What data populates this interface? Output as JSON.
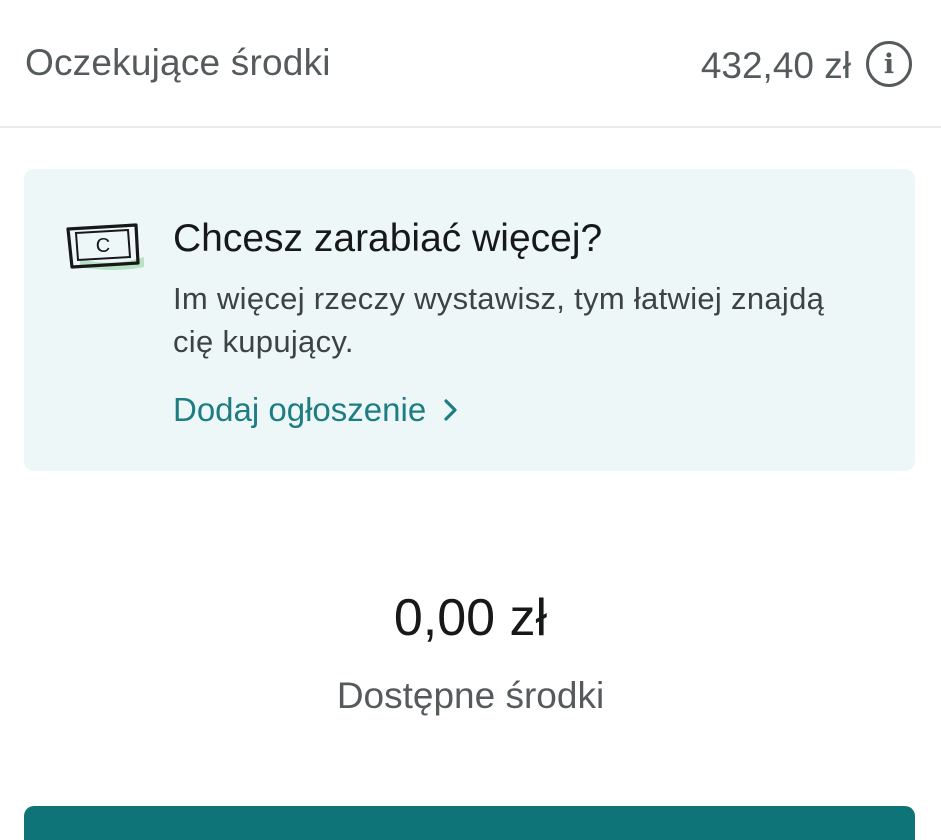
{
  "pending": {
    "label": "Oczekujące środki",
    "amount": "432,40 zł",
    "info_glyph": "i"
  },
  "promo": {
    "icon": "money-note-icon",
    "icon_letter": "C",
    "title": "Chcesz zarabiać więcej?",
    "body": "Im więcej rzeczy wystawisz, tym łatwiej znajdą cię kupujący.",
    "link_label": "Dodaj ogłoszenie"
  },
  "available": {
    "amount": "0,00 zł",
    "label": "Dostępne środki"
  },
  "colors": {
    "accent": "#1e7d82",
    "button": "#0f7478",
    "card_bg": "#eef7f8",
    "icon_highlight": "#b8e2c4"
  }
}
